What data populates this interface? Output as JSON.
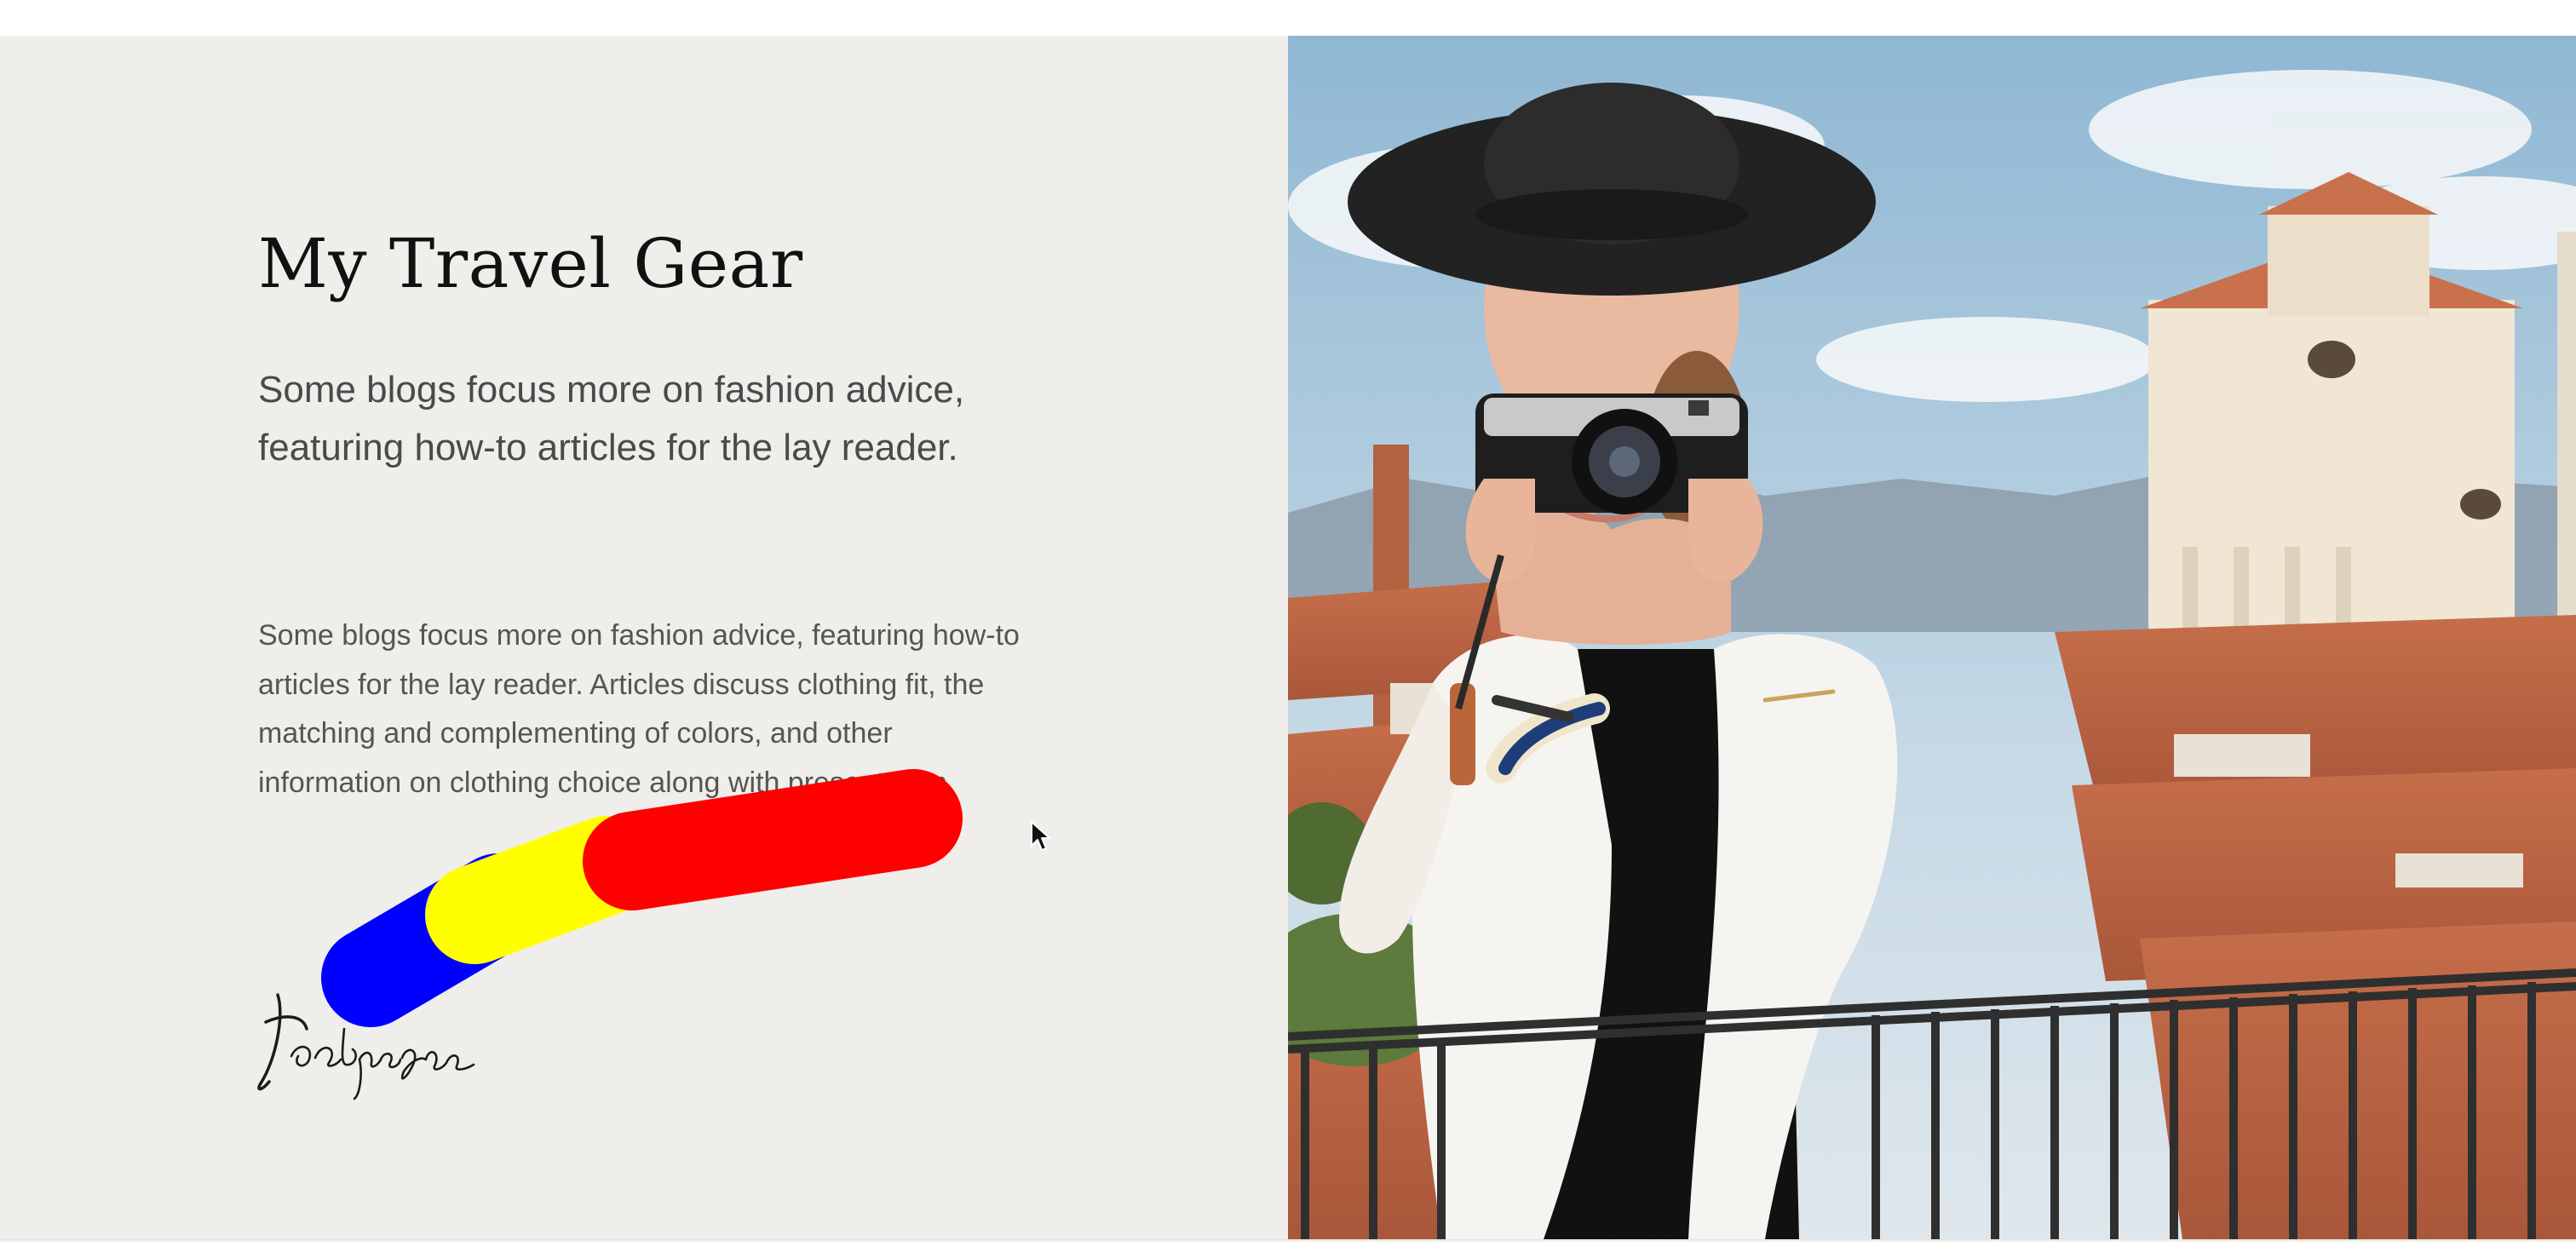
{
  "hero": {
    "title": "My Travel Gear",
    "lead": "Some blogs focus more on fashion advice, featuring how-to articles for the lay reader.",
    "body": "Some blogs focus more on fashion advice, featuring how-to articles for the lay reader. Articles discuss clothing fit, the matching and complementing of colors, and other information on clothing choice along with presentation.",
    "signature": "Joebyragpa"
  },
  "annotation": {
    "stroke_colors": [
      "#0000ff",
      "#ffff00",
      "#ff0000"
    ]
  },
  "photo": {
    "subject": "woman-with-camera-photo"
  },
  "colors": {
    "panel_bg": "#efeeea",
    "heading": "#111111",
    "text": "#4a4a4a"
  }
}
